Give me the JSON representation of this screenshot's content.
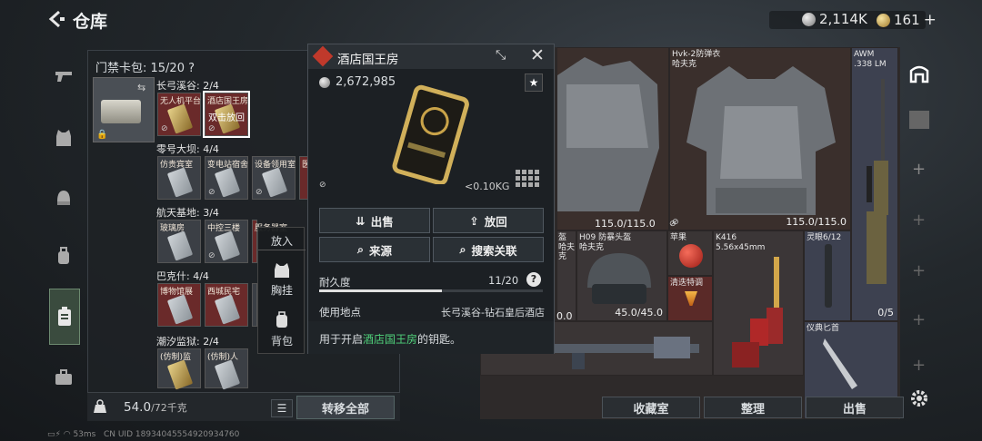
{
  "header": {
    "title": "仓库",
    "currency1": "2,114K",
    "currency2": "161",
    "plus": "+"
  },
  "left_panel": {
    "pass_label": "门禁卡包: 15/20",
    "pass_help": "?",
    "sections": [
      {
        "name": "长弓溪谷: 2/4",
        "cards": [
          "无人机平台",
          "酒店国王房"
        ]
      },
      {
        "name": "零号大坝: 4/4",
        "cards": [
          "仿贵宾室",
          "变电站宿舍",
          "设备领用室",
          "医"
        ]
      },
      {
        "name": "航天基地: 3/4",
        "cards": [
          "玻璃房",
          "中控三楼",
          "服务器室"
        ]
      },
      {
        "name": "巴克什: 4/4",
        "cards": [
          "博物馆展",
          "西城民宅",
          ""
        ]
      },
      {
        "name": "潮汐监狱: 2/4",
        "cards": [
          "(仿制)监",
          "(仿制)人"
        ]
      }
    ],
    "double_click_hint": "双击放回",
    "weight": "54.0",
    "weight_cap": "/72千克",
    "transfer_all": "转移全部"
  },
  "context_menu": {
    "put": "放入",
    "chest": "胸挂",
    "backpack": "背包"
  },
  "popup": {
    "title": "酒店国王房",
    "price": "2,672,985",
    "weight": "<0.10KG",
    "sell": "出售",
    "put_back": "放回",
    "source": "来源",
    "search_related": "搜索关联",
    "durability_label": "耐久度",
    "durability_value": "11/20",
    "durability": 0.55,
    "help": "?",
    "use_location_label": "使用地点",
    "use_location_value": "长弓溪谷-钻石皇后酒店",
    "desc_prefix": "用于开启",
    "desc_highlight": "酒店国王房",
    "desc_suffix": "的钥匙。"
  },
  "right_grid": {
    "armor1_name": "Hvk-2防弹衣",
    "armor1_sub": "哈夫克",
    "armor1_dur": "115.0/115.0",
    "armor2_dur": "115.0/115.0",
    "awm_name": "AWM",
    "awm_sub": ".338 LM",
    "helmet_name": "H09 防暴头盔",
    "helmet_sub": "哈夫克",
    "helmet_dur": "45.0/45.0",
    "left_partial_1": "盔",
    "left_partial_2": "哈夫克",
    "left_partial_dur": "0.0",
    "apple": "苹果",
    "drink": "清迭特调",
    "k416_name": "K416",
    "k416_sub": "5.56x45mm",
    "scope": "灵眼6/12",
    "awm_count": "0/5",
    "knife": "仪典匕首"
  },
  "bottom_bar": {
    "collection": "收藏室",
    "organize": "整理",
    "sell": "出售"
  },
  "status": {
    "ping": "53ms",
    "uid": "CN UID 18934045554920934760"
  }
}
